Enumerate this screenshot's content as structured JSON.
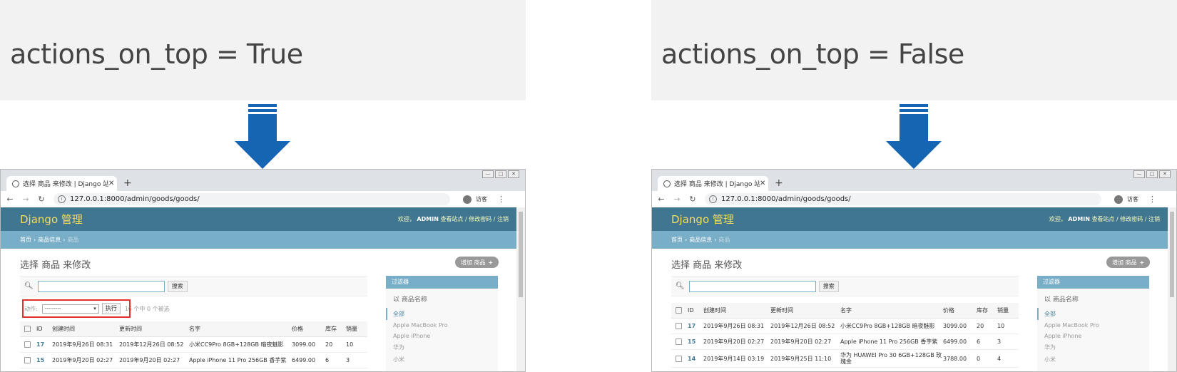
{
  "left": {
    "caption": "actions_on_top = True",
    "browser": {
      "tab_title": "选择 商品 来修改 | Django 站点",
      "url": "127.0.0.1:8000/admin/goods/goods/",
      "profile_label": "访客"
    },
    "admin": {
      "brand": "Django 管理",
      "welcome": "欢迎，",
      "username": "ADMIN",
      "user_links": "查看站点 / 修改密码 / 注销",
      "breadcrumb_home": "首页",
      "breadcrumb_app": "商品信息",
      "breadcrumb_current": "商品",
      "sep": "›",
      "page_title": "选择 商品 来修改",
      "add_button": "增加 商品",
      "search_button": "搜索",
      "action_label": "动作:",
      "action_select": "---------",
      "action_go": "执行",
      "selection_count": "16 个中 0 个被选",
      "filter_heading": "过滤器",
      "filter_title": "以 商品名称",
      "filter_options": [
        "全部",
        "Apple MacBook Pro",
        "Apple iPhone",
        "华为",
        "小米"
      ],
      "columns": {
        "id": "ID",
        "created": "创建时间",
        "updated": "更新时间",
        "name": "名字",
        "price": "价格",
        "stock": "库存",
        "sales": "销量"
      },
      "rows": [
        {
          "id": "17",
          "created": "2019年9月26日 08:31",
          "updated": "2019年12月26日 08:52",
          "name": "小米CC9Pro 8GB+128GB 暗夜魅影",
          "price": "3099.00",
          "stock": "20",
          "sales": "10"
        },
        {
          "id": "15",
          "created": "2019年9月20日 02:27",
          "updated": "2019年9月20日 02:27",
          "name": "Apple iPhone 11 Pro 256GB 香芋紫",
          "price": "6499.00",
          "stock": "6",
          "sales": "3"
        }
      ]
    }
  },
  "right": {
    "caption": "actions_on_top = False",
    "browser": {
      "tab_title": "选择 商品 来修改 | Django 站点",
      "url": "127.0.0.1:8000/admin/goods/goods/",
      "profile_label": "访客"
    },
    "admin": {
      "brand": "Django 管理",
      "welcome": "欢迎，",
      "username": "ADMIN",
      "user_links": "查看站点 / 修改密码 / 注销",
      "breadcrumb_home": "首页",
      "breadcrumb_app": "商品信息",
      "breadcrumb_current": "商品",
      "sep": "›",
      "page_title": "选择 商品 来修改",
      "add_button": "增加 商品",
      "search_button": "搜索",
      "filter_heading": "过滤器",
      "filter_title": "以 商品名称",
      "filter_options": [
        "全部",
        "Apple MacBook Pro",
        "Apple iPhone",
        "华为",
        "小米"
      ],
      "columns": {
        "id": "ID",
        "created": "创建时间",
        "updated": "更新时间",
        "name": "名字",
        "price": "价格",
        "stock": "库存",
        "sales": "销量"
      },
      "rows": [
        {
          "id": "17",
          "created": "2019年9月26日 08:31",
          "updated": "2019年12月26日 08:52",
          "name": "小米CC9Pro 8GB+128GB 暗夜魅影",
          "price": "3099.00",
          "stock": "20",
          "sales": "10"
        },
        {
          "id": "15",
          "created": "2019年9月20日 02:27",
          "updated": "2019年9月20日 02:27",
          "name": "Apple iPhone 11 Pro 256GB 香芋紫",
          "price": "6499.00",
          "stock": "6",
          "sales": "3"
        },
        {
          "id": "14",
          "created": "2019年9月14日 03:19",
          "updated": "2019年9月25日 11:10",
          "name": "华为 HUAWEI Pro 30 6GB+128GB 玫瑰金",
          "price": "3788.00",
          "stock": "0",
          "sales": "4"
        }
      ]
    }
  },
  "colors": {
    "arrow": "#1565b3",
    "header": "#417690",
    "breadcrumbs": "#79aec8",
    "brand": "#f5dd5d",
    "highlight": "#e0312f"
  }
}
